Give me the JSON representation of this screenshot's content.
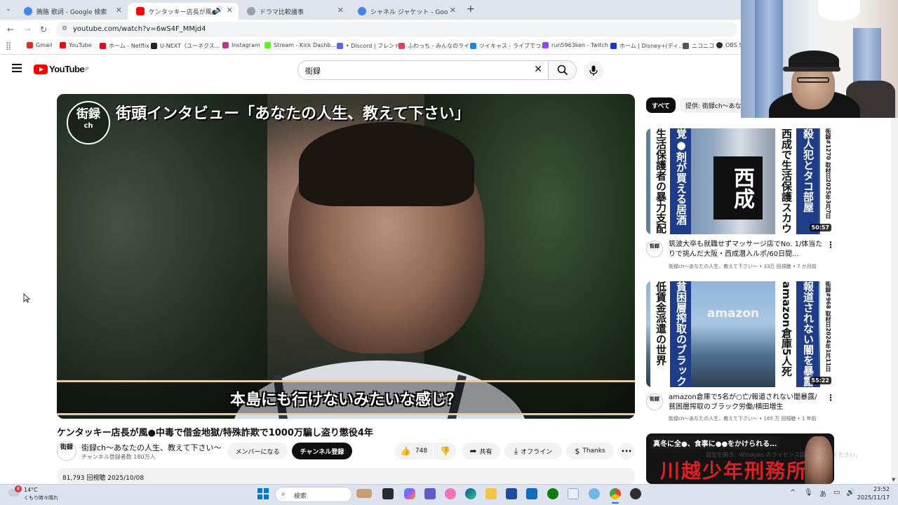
{
  "browser": {
    "tabs": [
      {
        "title": "賄賂 歌詞 - Google 検索",
        "active": false
      },
      {
        "title": "ケンタッキー店長が風●中毒で",
        "active": true
      },
      {
        "title": "ドラマ比較議事",
        "active": false
      },
      {
        "title": "シャネル ジャケット - Google 検索",
        "active": false
      }
    ],
    "new_tab": "+",
    "url": "youtube.com/watch?v=6wS4F_MMjd4"
  },
  "bookmarks": [
    {
      "label": "Gmail",
      "color": "#d93025"
    },
    {
      "label": "YouTube",
      "color": "#ff0000"
    },
    {
      "label": "ホーム - Netflix",
      "color": "#e50914"
    },
    {
      "label": "U-NEXT（ユーネクス...",
      "color": "#222222"
    },
    {
      "label": "Instagram",
      "color": "#c13584"
    },
    {
      "label": "Stream - Kick Dashb...",
      "color": "#53fc18"
    },
    {
      "label": "• Discord | フレンド",
      "color": "#5865f2"
    },
    {
      "label": "ふわっち - みんなのライ...",
      "color": "#e4405f"
    },
    {
      "label": "ツイキャス - ライブでつ...",
      "color": "#1e88e5"
    },
    {
      "label": "run5963ken - Twitch",
      "color": "#9146ff"
    },
    {
      "label": "ホーム | Disney+(ディ...",
      "color": "#113ccf"
    },
    {
      "label": "ニコニコ",
      "color": "#555555"
    },
    {
      "label": "OBS S",
      "color": "#302e31"
    }
  ],
  "youtube": {
    "logo_text": "YouTube",
    "logo_region": "JP",
    "search_value": "街録"
  },
  "video": {
    "overlay_title": "街頭インタビュー「あなたの人生、教えて下さい」",
    "overlay_logo": "街録",
    "overlay_logo_sub": "ch",
    "subtitle": "本島にも行けないみたいな感じ？",
    "title": "ケンタッキー店長が風●中毒で借金地獄/特殊詐欺で1000万騙し盗り懲役4年",
    "channel": {
      "name": "街録ch〜あなたの人生、教えて下さい〜",
      "subs": "チャンネル登録者数 180万人",
      "avatar": "街録"
    },
    "buttons": {
      "member": "メンバーになる",
      "subscribe": "チャンネル登録",
      "likes": "748",
      "share": "共有",
      "offline": "オフライン",
      "thanks": "Thanks",
      "more": "•••"
    },
    "stats": "81,793 回視聴  2025/10/08"
  },
  "sidebar": {
    "chips": [
      "すべて",
      "提供: 街録ch〜あな"
    ],
    "recommendations": [
      {
        "thumb_text_main": "西成",
        "thumb_text_a": "殺人犯とタコ部屋",
        "thumb_text_b": "生活保護者の暴力支配",
        "duration": "50:57",
        "title": "筑波大卒も就職せずマッサージ店でNo. 1/体当たりで挑んだ大阪・西成潜入ルポ/60日間...",
        "meta": "街録ch〜あなたの人生、教えて下さい〜 • 33万 回視聴 • 7 か月前"
      },
      {
        "thumb_text_main": "amazon",
        "thumb_text_a": "報道されない闇を暴露",
        "thumb_text_b": "低賃金派遣の世界",
        "duration": "55:22",
        "title": "amazon倉庫で5名が○亡/報道されない闇暴露/貧困層搾取のブラック労働/横田増生",
        "meta": "街録ch〜あなたの人生、教えて下さい〜 • 165 万 回視聴 • 1 年前"
      },
      {
        "thumb_text_main": "川越少年刑務所",
        "thumb_text_a": "真冬に全●、食事に●●をかけられる…",
        "duration": "",
        "title": "",
        "meta": ""
      }
    ]
  },
  "watermark": "設定を開き、Windows のライセンス認証を行ってください。",
  "taskbar": {
    "weather_temp": "14°C",
    "weather_desc": "くもり時々晴れ",
    "notification_count": "8",
    "search_label": "検索",
    "ime": "あ",
    "time": "23:52",
    "date": "2025/11/17"
  }
}
